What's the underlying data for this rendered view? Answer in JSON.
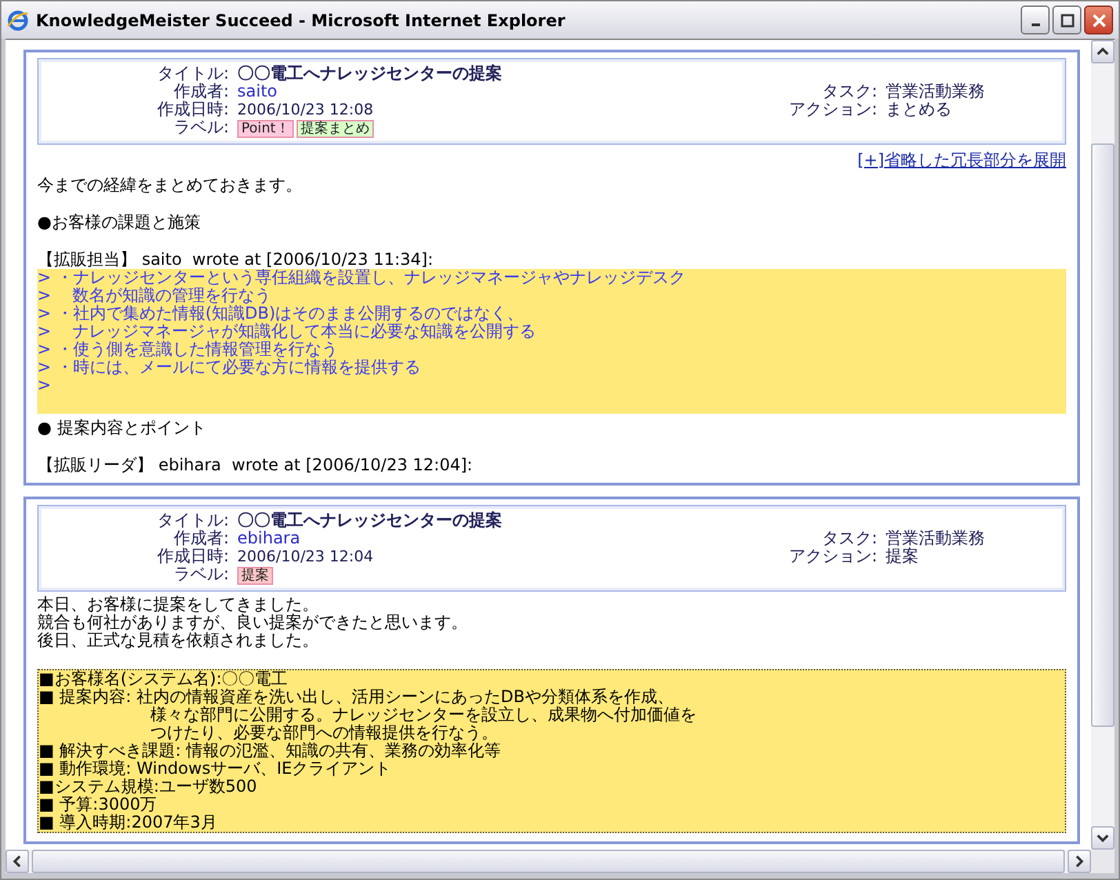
{
  "window": {
    "title": "KnowledgeMeister Succeed - Microsoft Internet Explorer"
  },
  "posts": [
    {
      "meta": {
        "title_label": "タイトル:",
        "title": "〇〇電工へナレッジセンターの提案",
        "author_label": "作成者:",
        "author": "saito",
        "created_label": "作成日時:",
        "created": "2006/10/23 12:08",
        "labels_label": "ラベル:",
        "labels": [
          {
            "text": "Point！",
            "color": "#ffc8dc"
          },
          {
            "text": "提案まとめ",
            "color": "#d8ffc8"
          }
        ],
        "task_label": "タスク:",
        "task": "営業活動業務",
        "action_label": "アクション:",
        "action": "まとめる"
      },
      "expand_link": "[+]省略した冗長部分を展開",
      "body": [
        {
          "kind": "para",
          "lines": [
            "今までの経緯をまとめておきます。"
          ]
        },
        {
          "kind": "heading",
          "text": "●お客様の課題と施策"
        },
        {
          "kind": "attribution",
          "text": "【拡販担当】 saito  wrote at [2006/10/23 11:34]:"
        },
        {
          "kind": "quote",
          "lines": [
            "> ・ナレッジセンターという専任組織を設置し、ナレッジマネージャやナレッジデスク",
            ">    数名が知識の管理を行なう",
            "> ・社内で集めた情報(知識DB)はそのまま公開するのではなく、",
            ">    ナレッジマネージャが知識化して本当に必要な知識を公開する",
            "> ・使う側を意識した情報管理を行なう",
            "> ・時には、メールにて必要な方に情報を提供する",
            ">"
          ]
        },
        {
          "kind": "heading",
          "text": "● 提案内容とポイント"
        },
        {
          "kind": "attribution",
          "text": "【拡販リーダ】 ebihara  wrote at [2006/10/23 12:04]:"
        }
      ]
    },
    {
      "meta": {
        "title_label": "タイトル:",
        "title": "〇〇電工へナレッジセンターの提案",
        "author_label": "作成者:",
        "author": "ebihara",
        "created_label": "作成日時:",
        "created": "2006/10/23 12:04",
        "labels_label": "ラベル:",
        "labels": [
          {
            "text": "提案",
            "color": "#ffc8c8"
          }
        ],
        "task_label": "タスク:",
        "task": "営業活動業務",
        "action_label": "アクション:",
        "action": "提案"
      },
      "body": [
        {
          "kind": "para",
          "lines": [
            "本日、お客様に提案をしてきました。",
            "競合も何社がありますが、良い提案ができたと思います。",
            "後日、正式な見積を依頼されました。"
          ]
        },
        {
          "kind": "memo",
          "lines": [
            {
              "kind": "item",
              "text": "■お客様名(システム名):〇〇電工"
            },
            {
              "kind": "item",
              "text": "■ 提案内容: 社内の情報資産を洗い出し、活用シーンにあったDBや分類体系を作成、"
            },
            {
              "kind": "cont",
              "text": "様々な部門に公開する。ナレッジセンターを設立し、成果物へ付加価値を"
            },
            {
              "kind": "cont",
              "text": "つけたり、必要な部門への情報提供を行なう。"
            },
            {
              "kind": "item",
              "text": "■ 解決すべき課題: 情報の氾濫、知識の共有、業務の効率化等"
            },
            {
              "kind": "item",
              "text": "■ 動作環境: Windowsサーバ、IEクライアント"
            },
            {
              "kind": "item",
              "text": "■システム規模:ユーザ数500"
            },
            {
              "kind": "item",
              "text": "■ 予算:3000万"
            },
            {
              "kind": "item",
              "text": "■ 導入時期:2007年3月"
            }
          ]
        }
      ]
    }
  ]
}
